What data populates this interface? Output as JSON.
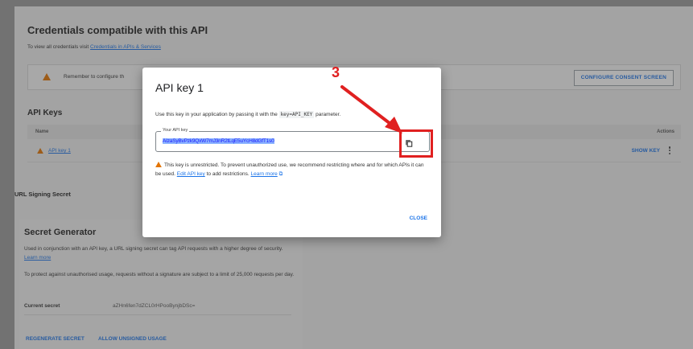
{
  "credentials": {
    "title": "Credentials compatible with this API",
    "subtitle_prefix": "To view all credentials visit ",
    "subtitle_link": "Credentials in APIs & Services"
  },
  "banner": {
    "text": "Remember to configure th",
    "button_label": "CONFIGURE CONSENT SCREEN"
  },
  "api_keys": {
    "heading": "API Keys",
    "columns": {
      "name": "Name",
      "actions": "Actions"
    },
    "rows": [
      {
        "name": "API key 1",
        "show_key_label": "SHOW KEY"
      }
    ]
  },
  "url_signing": {
    "heading": "URL Signing Secret"
  },
  "secret_generator": {
    "title": "Secret Generator",
    "description": "Used in conjunction with an API key, a URL signing secret can tag API requests with a higher degree of security.",
    "learn_more": "Learn more",
    "limit_text": "To protect against unauthorised usage, requests without a signature are subject to a limit of 25,000 requests per day.",
    "current_secret_label": "Current secret",
    "current_secret_value": "aZHn6fen7dZCL0rHPooBynjbDSc=",
    "regenerate_label": "REGENERATE SECRET",
    "allow_unsigned_label": "ALLOW UNSIGNED USAGE"
  },
  "modal": {
    "title": "API key 1",
    "desc_prefix": "Use this key in your application by passing it with the ",
    "desc_code": "key=API_KEY",
    "desc_suffix": " parameter.",
    "field_label": "Your API key",
    "key_value": "AIzaSyBvPzk9QxW7mJ3nR2tLqE5uYcH8dGfT1s0",
    "warning_text": "This key is unrestricted. To prevent unauthorized use, we recommend restricting where and for which APIs it can be used. ",
    "edit_link": "Edit API key",
    "warning_suffix": " to add restrictions. ",
    "learn_more": "Learn more",
    "close_label": "CLOSE"
  },
  "annotation": {
    "step": "3",
    "color": "#e02020"
  },
  "colors": {
    "accent": "#1a73e8",
    "warning": "#e37400"
  }
}
